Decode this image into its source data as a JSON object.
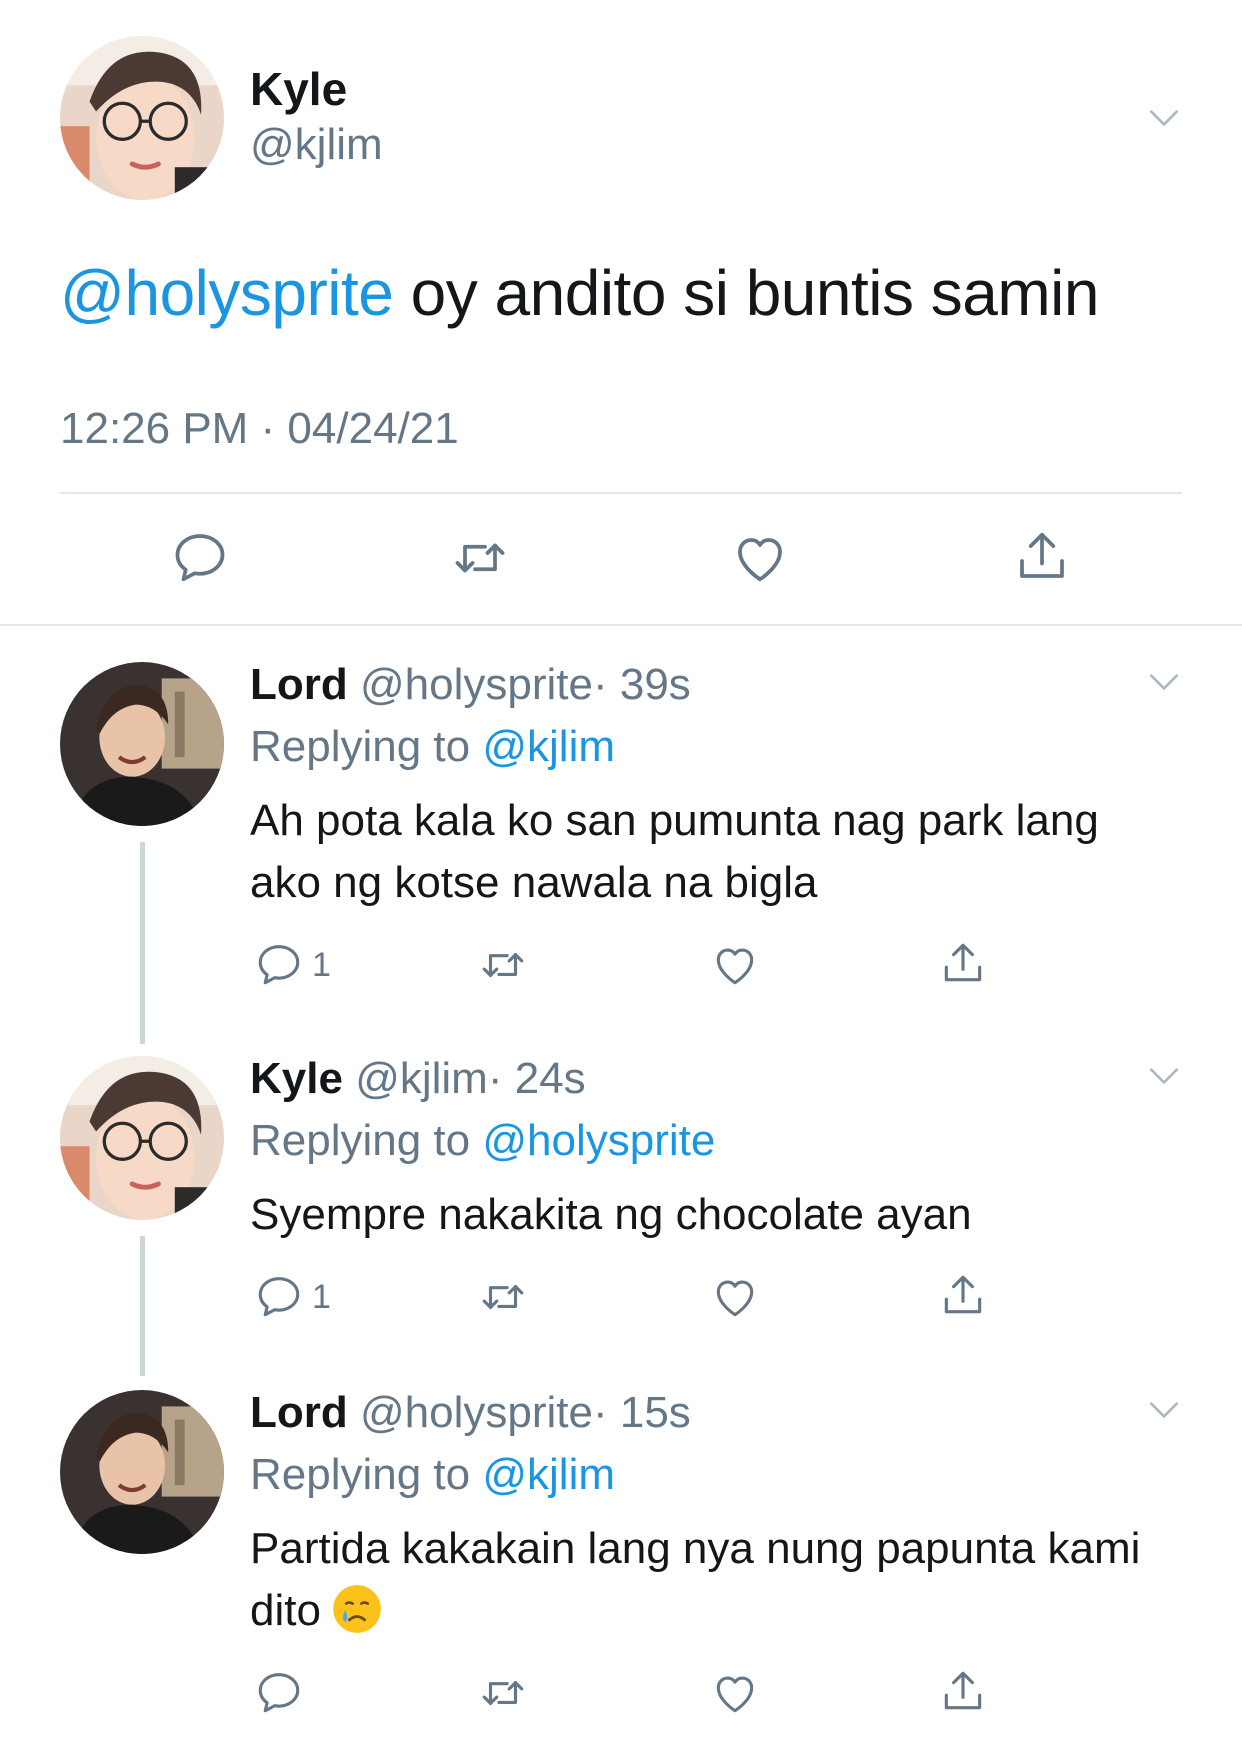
{
  "main_tweet": {
    "name": "Kyle",
    "handle": "@kjlim",
    "mention": "@holysprite",
    "text": " oy andito si buntis samin",
    "timestamp": "12:26 PM · 04/24/21",
    "avatar_icon": "kyle-avatar-photo",
    "actions": [
      "reply-icon",
      "retweet-icon",
      "like-icon",
      "share-icon"
    ]
  },
  "replies": [
    {
      "name": "Lord",
      "handle": "@holysprite",
      "time": "· 39s",
      "replying_prefix": "Replying to ",
      "replying_to": "@kjlim",
      "text": "Ah pota kala ko san pumunta nag park lang ako ng kotse nawala na bigla",
      "reply_count": "1"
    },
    {
      "name": "Kyle",
      "handle": "@kjlim",
      "time": "· 24s",
      "replying_prefix": "Replying to ",
      "replying_to": "@holysprite",
      "text": "Syempre nakakita ng chocolate ayan",
      "reply_count": "1"
    },
    {
      "name": "Lord",
      "handle": "@holysprite",
      "time": "· 15s",
      "replying_prefix": "Replying to ",
      "replying_to": "@kjlim",
      "text": "Partida kakakain lang nya nung papunta kami dito",
      "reply_count": "",
      "emoji": "crying-face-emoji"
    }
  ],
  "colors": {
    "link": "#1b95e0",
    "muted": "#657786",
    "divider": "#e1e8ed",
    "thread_line": "#ccd6dd"
  }
}
